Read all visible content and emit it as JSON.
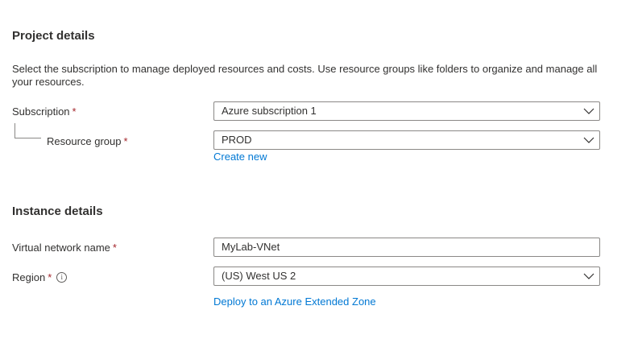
{
  "project_details": {
    "heading": "Project details",
    "description": "Select the subscription to manage deployed resources and costs. Use resource groups like folders to organize and manage all your resources.",
    "subscription": {
      "label": "Subscription",
      "required_marker": "*",
      "value": "Azure subscription 1"
    },
    "resource_group": {
      "label": "Resource group",
      "required_marker": "*",
      "value": "PROD",
      "create_new_link": "Create new"
    }
  },
  "instance_details": {
    "heading": "Instance details",
    "vnet_name": {
      "label": "Virtual network name",
      "required_marker": "*",
      "value": "MyLab-VNet"
    },
    "region": {
      "label": "Region",
      "required_marker": "*",
      "info_icon": "i",
      "value": "(US) West US 2",
      "extended_zone_link": "Deploy to an Azure Extended Zone"
    }
  },
  "colors": {
    "required": "#a4262c",
    "link": "#0078d4",
    "border": "#8a8886",
    "text": "#323130"
  }
}
